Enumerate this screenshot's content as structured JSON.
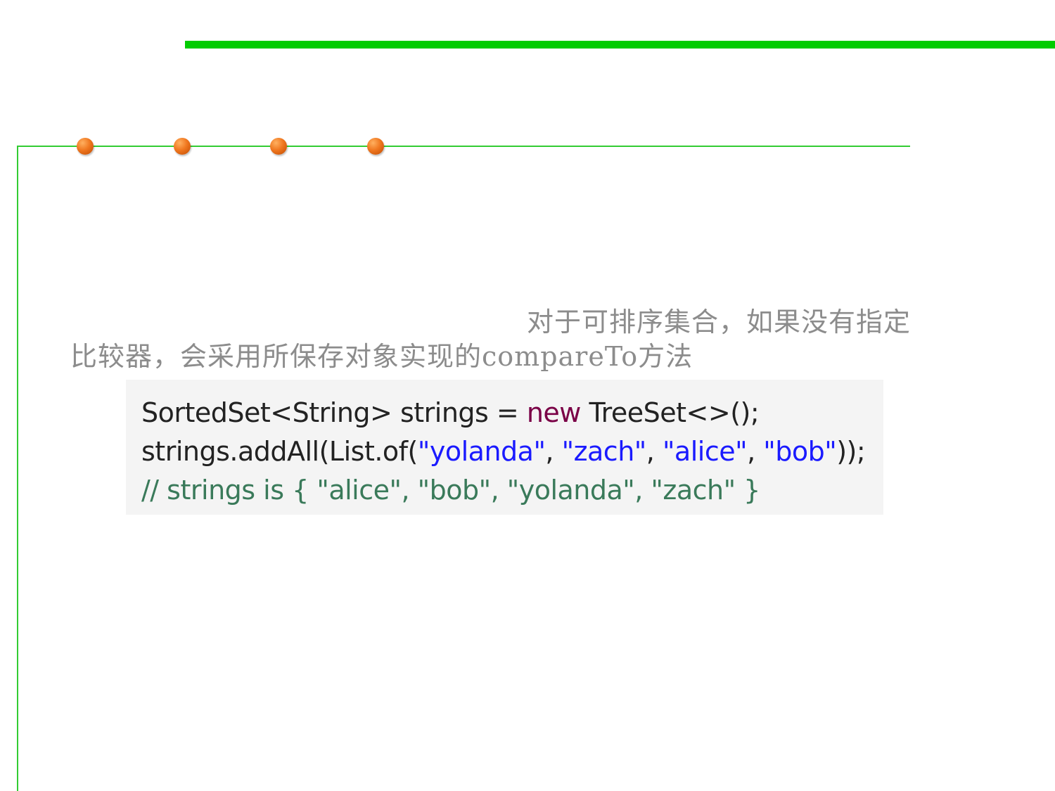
{
  "decor": {
    "accent_green": "#00cc00",
    "frame_green": "#33cc33",
    "dot_color": "#f07820"
  },
  "body": {
    "line1": "对于可排序集合，如果没有指定",
    "line2": "比较器，会采用所保存对象实现的compareTo方法"
  },
  "code": {
    "line1": {
      "a": "SortedSet<String> strings = ",
      "kw": "new",
      "b": " TreeSet<>();"
    },
    "line2": {
      "a": "strings.addAll(List.of(",
      "s1": "\"yolanda\"",
      "c1": ", ",
      "s2": "\"zach\"",
      "c2": ", ",
      "s3": "\"alice\"",
      "c3": ", ",
      "s4": "\"bob\"",
      "b": "));"
    },
    "line3": "// strings is { \"alice\", \"bob\", \"yolanda\", \"zach\" }"
  }
}
